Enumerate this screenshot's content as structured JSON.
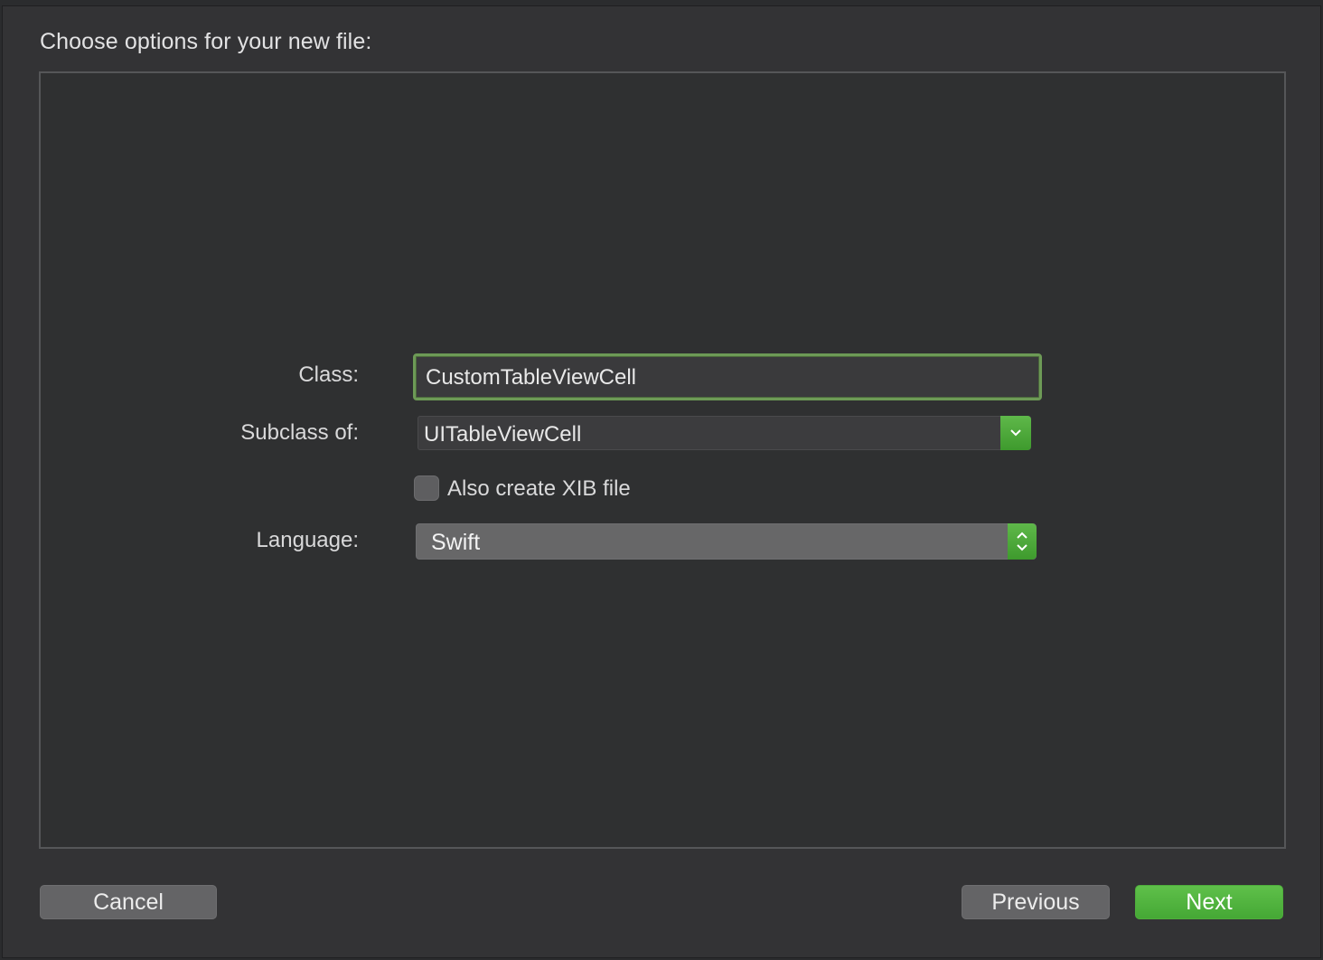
{
  "dialog": {
    "title": "Choose options for your new file:"
  },
  "form": {
    "class_label": "Class:",
    "class_value": "CustomTableViewCell",
    "subclass_label": "Subclass of:",
    "subclass_value": "UITableViewCell",
    "xib_label": "Also create XIB file",
    "xib_checked": false,
    "language_label": "Language:",
    "language_value": "Swift"
  },
  "buttons": {
    "cancel": "Cancel",
    "previous": "Previous",
    "next": "Next"
  },
  "colors": {
    "accent_green": "#5fb84a",
    "focus_ring": "#6d9a56",
    "background": "#333335"
  },
  "icons": {
    "subclass_dropdown": "chevron-down-icon",
    "language_popup": "up-down-chevron-icon"
  }
}
